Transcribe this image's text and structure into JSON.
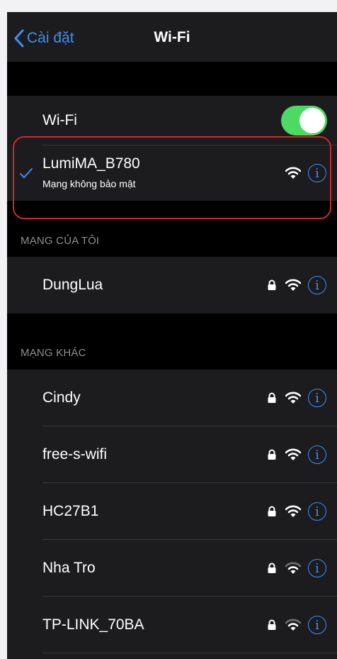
{
  "nav": {
    "back_label": "Cài đặt",
    "title": "Wi-Fi"
  },
  "wifi_toggle": {
    "label": "Wi-Fi",
    "on": true
  },
  "connected": {
    "name": "LumiMA_B780",
    "status": "Mạng không bảo mật",
    "secured": false
  },
  "my_networks": {
    "header": "MẠNG CỦA TÔI",
    "items": [
      {
        "name": "DungLua",
        "secured": true
      }
    ]
  },
  "other_networks": {
    "header": "MẠNG KHÁC",
    "items": [
      {
        "name": "Cindy",
        "secured": true
      },
      {
        "name": "free-s-wifi",
        "secured": true
      },
      {
        "name": "HC27B1",
        "secured": true
      },
      {
        "name": "Nha Tro",
        "secured": true
      },
      {
        "name": "TP-LINK_70BA",
        "secured": true
      }
    ]
  },
  "colors": {
    "accent": "#3e8ef7",
    "toggle_on": "#4cd964",
    "highlight": "#d0262b"
  },
  "icons": {
    "info": "i"
  }
}
